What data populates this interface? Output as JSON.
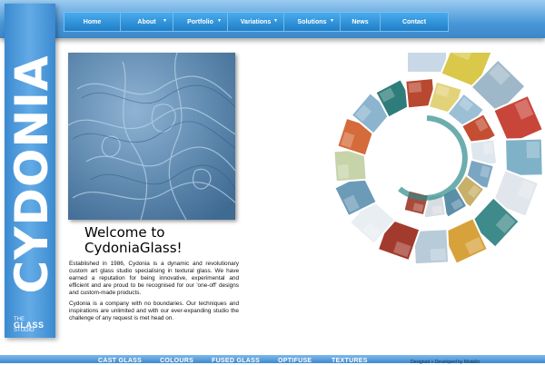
{
  "nav": {
    "items": [
      {
        "label": "Home",
        "dropdown": false
      },
      {
        "label": "About",
        "dropdown": true
      },
      {
        "label": "Portfolio",
        "dropdown": true
      },
      {
        "label": "Variations",
        "dropdown": true
      },
      {
        "label": "Solutions",
        "dropdown": true
      },
      {
        "label": "News",
        "dropdown": false
      },
      {
        "label": "Contact",
        "dropdown": false
      }
    ]
  },
  "logo": {
    "word": "CYDONIA",
    "sub_the": "THE",
    "sub_glass": "GLASS",
    "sub_studio": "STUDIO"
  },
  "welcome": {
    "line1": "Welcome to",
    "line2": "CydoniaGlass!"
  },
  "intro": {
    "p1": "Established in 1986, Cydonia is a dynamic and revolutionary custom art glass studio specialising in textural glass. We have earned a reputation for being innovative, experimental and efficient and are proud to be recognised for our 'one-off' designs and custom-made products.",
    "p2": "Cydonia is a company with no boundaries. Our techniques and inspirations are unlimited and with our ever-expanding studio the challenge of any request is met head on."
  },
  "footer_links": [
    "CAST GLASS",
    "COLOURS",
    "FUSED GLASS",
    "OPTIFUSE",
    "TEXTURES"
  ],
  "credit": "Designed + Developed by Modelln",
  "colors": {
    "accent": "#3b86c8",
    "menu": "#1f7ec8",
    "sidebar": "#4a98d8"
  }
}
